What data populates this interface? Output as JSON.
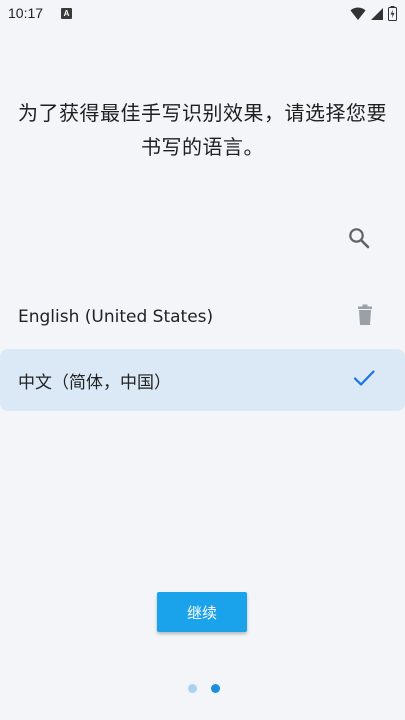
{
  "status_bar": {
    "time": "10:17",
    "app_icon_letter": "A",
    "icons": [
      "wifi-icon",
      "signal-icon",
      "battery-icon"
    ]
  },
  "headline": {
    "line1": "为了获得最佳手写识别效果，请选择您要",
    "line2": "书写的语言。"
  },
  "search": {
    "icon": "search-icon"
  },
  "languages": [
    {
      "label": "English (United States)",
      "action_icon": "trash-icon"
    },
    {
      "label": "中文（简体，中国）",
      "action_icon": "check-icon",
      "selected": true
    }
  ],
  "continue_button": {
    "label": "继续"
  },
  "pager": {
    "total": 2,
    "current": 2
  },
  "colors": {
    "background": "#f3f5f8",
    "accent": "#1aa3ea",
    "selected_row": "#dbe9f6",
    "check": "#1a73e8",
    "dot_inactive": "#a8d4f3",
    "dot_active": "#1a8fe0"
  }
}
